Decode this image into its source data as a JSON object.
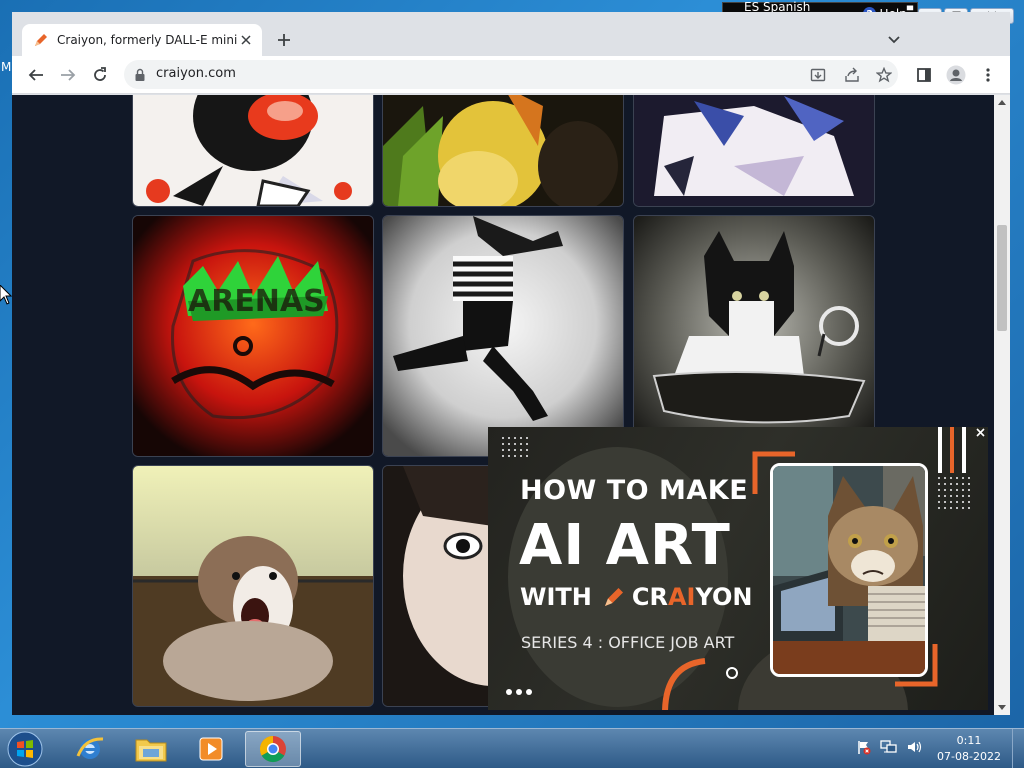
{
  "desktop": {
    "edge_letter": "M"
  },
  "language_bar": {
    "language": "ES Spanish (Chile)",
    "help": "Help"
  },
  "browser": {
    "tab": {
      "title": "Craiyon, formerly DALL-E mini",
      "favicon": "pencil-icon"
    },
    "address": {
      "url": "craiyon.com"
    },
    "toolbar_icons": [
      "back-icon",
      "forward-icon",
      "reload-icon",
      "lock-icon",
      "install-icon",
      "share-icon",
      "star-icon",
      "sidepanel-icon",
      "profile-icon",
      "menu-icon"
    ]
  },
  "gallery": {
    "images": [
      "cartoon-character-image",
      "yellow-figure-image",
      "blue-white-abstract-image",
      "red-graffiti-text-image",
      "jumping-person-image",
      "cat-image",
      "dog-image",
      "face-image"
    ]
  },
  "ad": {
    "line1": "HOW TO MAKE",
    "line2": "AI ART",
    "line3_prefix": "WITH",
    "brand_part1": "CR",
    "brand_part2": "AI",
    "brand_part3": "YON",
    "series": "SERIES 4 : OFFICE JOB ART",
    "accent_color": "#e8652a"
  },
  "taskbar": {
    "apps": [
      "internet-explorer",
      "file-explorer",
      "media-player",
      "chrome"
    ],
    "time": "0:11",
    "date": "07-08-2022"
  }
}
